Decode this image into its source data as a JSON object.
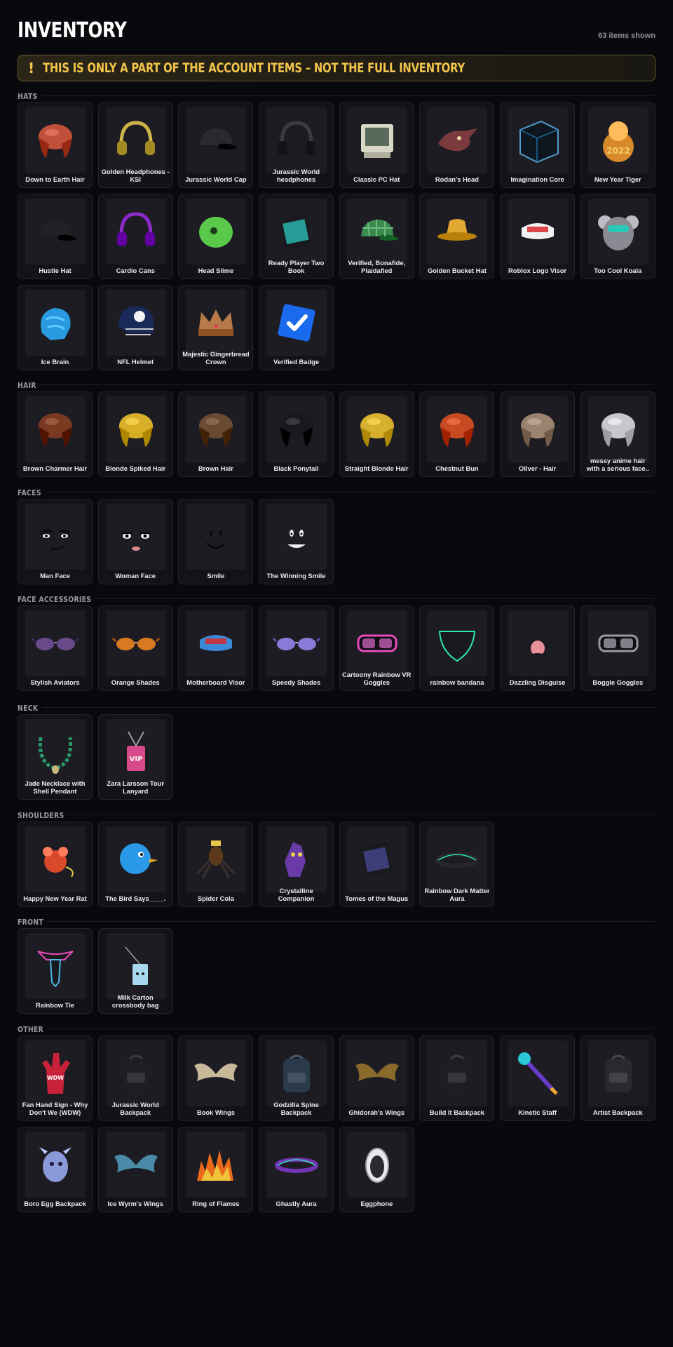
{
  "header": {
    "title": "INVENTORY",
    "count": "63 items shown"
  },
  "banner": {
    "icon": "!",
    "text": "THIS IS ONLY A PART OF THE ACCOUNT ITEMS – NOT THE FULL INVENTORY"
  },
  "sections": [
    {
      "title": "HATS",
      "items": [
        {
          "name": "Down to Earth Hair",
          "icon": "hair-icon",
          "color": "#c0503a"
        },
        {
          "name": "Golden Headphones - KSI",
          "icon": "headphones-icon",
          "color": "#c9b24a"
        },
        {
          "name": "Jurassic World Cap",
          "icon": "cap-icon",
          "color": "#2a2a2e"
        },
        {
          "name": "Jurassic World headphones",
          "icon": "headphones-icon",
          "color": "#3a3a40"
        },
        {
          "name": "Classic PC Hat",
          "icon": "computer-icon",
          "color": "#d8d6c4"
        },
        {
          "name": "Rodan's Head",
          "icon": "creature-head-icon",
          "color": "#7a3a3e"
        },
        {
          "name": "Imagination Core",
          "icon": "cube-icon",
          "color": "#1e6a9a"
        },
        {
          "name": "New Year Tiger",
          "icon": "tiger-icon",
          "color": "#d88a2a"
        },
        {
          "name": "Hustle Hat",
          "icon": "cap-icon",
          "color": "#202026"
        },
        {
          "name": "Cardio Cans",
          "icon": "headphones-icon",
          "color": "#8a2ac8"
        },
        {
          "name": "Head Slime",
          "icon": "slime-icon",
          "color": "#5ac84a"
        },
        {
          "name": "Ready Player Two Book",
          "icon": "book-icon",
          "color": "#2ac8c0"
        },
        {
          "name": "Verified, Bonafide, Plaidafied",
          "icon": "plaid-cap-icon",
          "color": "#3a8a4e"
        },
        {
          "name": "Golden Bucket Hat",
          "icon": "bucket-hat-icon",
          "color": "#e0a830"
        },
        {
          "name": "Roblox Logo Visor",
          "icon": "visor-icon",
          "color": "#f2f2f2"
        },
        {
          "name": "Too Cool Koala",
          "icon": "koala-icon",
          "color": "#8a8a92"
        },
        {
          "name": "Ice Brain",
          "icon": "brain-icon",
          "color": "#2a9ae0"
        },
        {
          "name": "NFL Helmet",
          "icon": "helmet-icon",
          "color": "#1a2a5a"
        },
        {
          "name": "Majestic Gingerbread Crown",
          "icon": "crown-icon",
          "color": "#b87a4a"
        },
        {
          "name": "Verified Badge",
          "icon": "verified-badge-icon",
          "color": "#1a6aee"
        }
      ]
    },
    {
      "title": "HAIR",
      "items": [
        {
          "name": "Brown Charmer Hair",
          "icon": "hair-icon",
          "color": "#7a3a22"
        },
        {
          "name": "Blonde Spiked Hair",
          "icon": "hair-icon",
          "color": "#d8b028"
        },
        {
          "name": "Brown Hair",
          "icon": "hair-icon",
          "color": "#6a4a30"
        },
        {
          "name": "Black Ponytail",
          "icon": "hair-icon",
          "color": "#1a1a1e"
        },
        {
          "name": "Straight Blonde Hair",
          "icon": "hair-icon",
          "color": "#d8b030"
        },
        {
          "name": "Chestnut Bun",
          "icon": "hair-icon",
          "color": "#c84a22"
        },
        {
          "name": "Oliver - Hair",
          "icon": "hair-icon",
          "color": "#9a8470"
        },
        {
          "name": "messy anime hair with a serious face..",
          "icon": "hair-icon",
          "color": "#c8c8cc"
        }
      ]
    },
    {
      "title": "FACES",
      "items": [
        {
          "name": "Man Face",
          "icon": "face-icon",
          "color": "#0a0a0c"
        },
        {
          "name": "Woman Face",
          "icon": "face-icon",
          "color": "#0a0a0c"
        },
        {
          "name": "Smile",
          "icon": "face-icon",
          "color": "#0a0a0c"
        },
        {
          "name": "The Winning Smile",
          "icon": "face-icon",
          "color": "#0a0a0c"
        }
      ]
    },
    {
      "title": "FACE ACCESSORIES",
      "items": [
        {
          "name": "Stylish Aviators",
          "icon": "glasses-icon",
          "color": "#6a4a8a"
        },
        {
          "name": "Orange Shades",
          "icon": "glasses-icon",
          "color": "#d87a22"
        },
        {
          "name": "Motherboard Visor",
          "icon": "visor-icon",
          "color": "#3a8ad8"
        },
        {
          "name": "Speedy Shades",
          "icon": "glasses-icon",
          "color": "#8a7ad8"
        },
        {
          "name": "Cartoony Rainbow VR Goggles",
          "icon": "goggles-icon",
          "color": "#e84ab8"
        },
        {
          "name": "rainbow bandana",
          "icon": "bandana-icon",
          "color": "#1a1a1e"
        },
        {
          "name": "Dazzling Disguise",
          "icon": "disguise-icon",
          "color": "#e8909a"
        },
        {
          "name": "Boggle Goggles",
          "icon": "goggles-icon",
          "color": "#9a9aa2"
        }
      ]
    },
    {
      "title": "NECK",
      "items": [
        {
          "name": "Jade Necklace with Shell Pendant",
          "icon": "necklace-icon",
          "color": "#2a9a6a"
        },
        {
          "name": "Zara Larsson Tour Lanyard",
          "icon": "lanyard-icon",
          "color": "#d84a8a"
        }
      ]
    },
    {
      "title": "SHOULDERS",
      "items": [
        {
          "name": "Happy New Year Rat",
          "icon": "rat-icon",
          "color": "#d84a2a"
        },
        {
          "name": "The Bird Says____.",
          "icon": "bird-icon",
          "color": "#2a9ae8"
        },
        {
          "name": "Spider Cola",
          "icon": "spider-icon",
          "color": "#3a3030"
        },
        {
          "name": "Crystalline Companion",
          "icon": "companion-icon",
          "color": "#6a3aa8"
        },
        {
          "name": "Tomes of the Magus",
          "icon": "book-icon",
          "color": "#4a4a9a"
        },
        {
          "name": "Rainbow Dark Matter Aura",
          "icon": "aura-icon",
          "color": "#2a2a2e"
        }
      ]
    },
    {
      "title": "FRONT",
      "items": [
        {
          "name": "Rainbow Tie",
          "icon": "tie-icon",
          "color": "#1a1a1e"
        },
        {
          "name": "Milk Carton crossbody bag",
          "icon": "bag-icon",
          "color": "#a8d8f0"
        }
      ]
    },
    {
      "title": "OTHER",
      "items": [
        {
          "name": "Fan Hand Sign - Why Don't We (WDW)",
          "icon": "foam-hand-icon",
          "color": "#c8223a"
        },
        {
          "name": "Jurassic World Backpack",
          "icon": "backpack-icon",
          "color": "#1e1e22"
        },
        {
          "name": "Book Wings",
          "icon": "wings-icon",
          "color": "#c8b89a"
        },
        {
          "name": "Godzilla Spine Backpack",
          "icon": "backpack-icon",
          "color": "#2a3a4a"
        },
        {
          "name": "Ghidorah's Wings",
          "icon": "wings-icon",
          "color": "#8a6a2a"
        },
        {
          "name": "Build It Backpack",
          "icon": "backpack-icon",
          "color": "#1e1e22"
        },
        {
          "name": "Kinetic Staff",
          "icon": "staff-icon",
          "color": "#6a3ac8"
        },
        {
          "name": "Artist Backpack",
          "icon": "backpack-icon",
          "color": "#2a2a2e"
        },
        {
          "name": "Boro Egg Backpack",
          "icon": "egg-backpack-icon",
          "color": "#8a9ad8"
        },
        {
          "name": "Ice Wyrm's Wings",
          "icon": "wings-icon",
          "color": "#4a8aa8"
        },
        {
          "name": "Ring of Flames",
          "icon": "flames-icon",
          "color": "#e86a1a"
        },
        {
          "name": "Ghastly Aura",
          "icon": "aura-icon",
          "color": "#8a3ad8"
        },
        {
          "name": "Eggphone",
          "icon": "egg-icon",
          "color": "#e8e8ee"
        }
      ]
    }
  ]
}
